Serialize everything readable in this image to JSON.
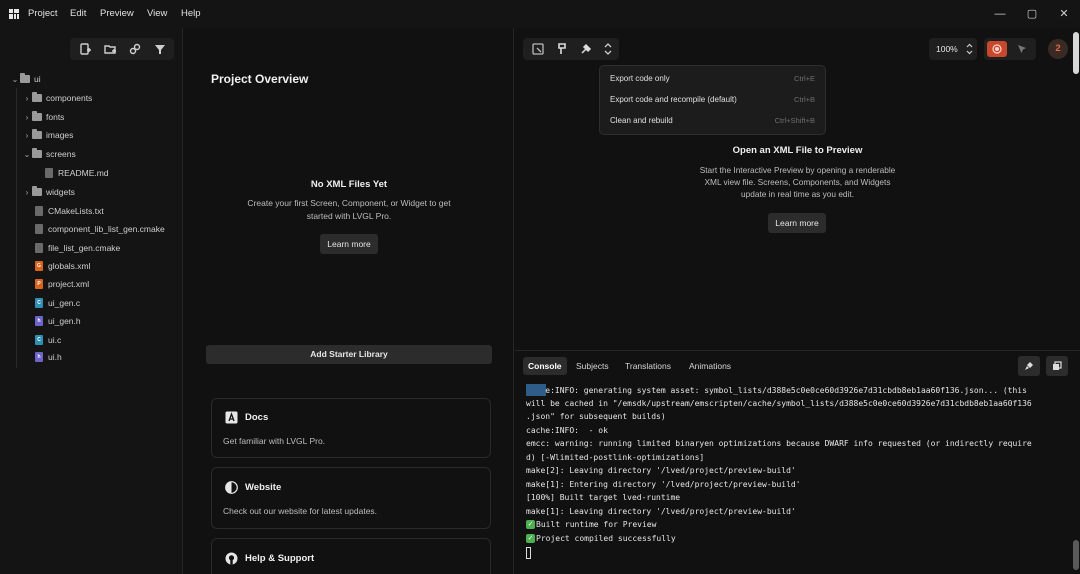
{
  "menubar": {
    "items": [
      "Project",
      "Edit",
      "Preview",
      "View",
      "Help"
    ]
  },
  "window_controls": {
    "minimize": "—",
    "maximize": "▢",
    "close": "✕"
  },
  "file_tree": {
    "root": "ui",
    "items": [
      {
        "label": "components",
        "type": "folder",
        "expanded": false
      },
      {
        "label": "fonts",
        "type": "folder",
        "expanded": false
      },
      {
        "label": "images",
        "type": "folder",
        "expanded": false
      },
      {
        "label": "screens",
        "type": "folder",
        "expanded": true
      },
      {
        "label": "README.md",
        "type": "file"
      },
      {
        "label": "widgets",
        "type": "folder",
        "expanded": false
      },
      {
        "label": "CMakeLists.txt",
        "type": "file"
      },
      {
        "label": "component_lib_list_gen.cmake",
        "type": "file"
      },
      {
        "label": "file_list_gen.cmake",
        "type": "file"
      },
      {
        "label": "globals.xml",
        "type": "xml-globals"
      },
      {
        "label": "project.xml",
        "type": "xml-project"
      },
      {
        "label": "ui_gen.c",
        "type": "c"
      },
      {
        "label": "ui_gen.h",
        "type": "h"
      },
      {
        "label": "ui.c",
        "type": "c"
      },
      {
        "label": "ui.h",
        "type": "h"
      }
    ]
  },
  "overview": {
    "title": "Project Overview",
    "empty_title": "No XML Files Yet",
    "empty_text_1": "Create your first Screen, Component, or Widget to get",
    "empty_text_2": "started with LVGL Pro.",
    "learn_more": "Learn more",
    "add_starter": "Add Starter Library",
    "cards": [
      {
        "title": "Docs",
        "text": "Get familiar with LVGL Pro."
      },
      {
        "title": "Website",
        "text": "Check out our website for latest updates."
      },
      {
        "title": "Help & Support",
        "text": ""
      }
    ]
  },
  "preview": {
    "zoom": "100%",
    "notification_count": "2",
    "dropdown": [
      {
        "label": "Export code only",
        "shortcut": "Ctrl+E"
      },
      {
        "label": "Export code and recompile (default)",
        "shortcut": "Ctrl+B"
      },
      {
        "label": "Clean and rebuild",
        "shortcut": "Ctrl+Shift+B"
      }
    ],
    "empty_title": "Open an XML File to Preview",
    "empty_text_1": "Start the Interactive Preview by opening a renderable",
    "empty_text_2": "XML view file. Screens, Components, and Widgets",
    "empty_text_3": "update in real time as you edit.",
    "learn_more": "Learn more"
  },
  "console": {
    "tabs": [
      "Console",
      "Subjects",
      "Translations",
      "Animations"
    ],
    "lines": [
      "    e:INFO: generating system asset: symbol_lists/d388e5c0e0ce60d3926e7d31cbdb8eb1aa60f136.json... (this",
      "will be cached in \"/emsdk/upstream/emscripten/cache/symbol_lists/d388e5c0e0ce60d3926e7d31cbdb8eb1aa60f136",
      ".json\" for subsequent builds)",
      "cache:INFO:  - ok",
      "emcc: warning: running limited binaryen optimizations because DWARF info requested (or indirectly require",
      "d) [-Wlimited-postlink-optimizations]",
      "make[2]: Leaving directory '/lved/project/preview-build'",
      "make[1]: Entering directory '/lved/project/preview-build'",
      "[100%] Built target lved-runtime",
      "make[1]: Leaving directory '/lved/project/preview-build'",
      "Built runtime for Preview",
      "Project compiled successfully"
    ]
  },
  "colors": {
    "accent": "#e0563a",
    "check": "#4caf50",
    "selection": "#2f5d8a"
  }
}
